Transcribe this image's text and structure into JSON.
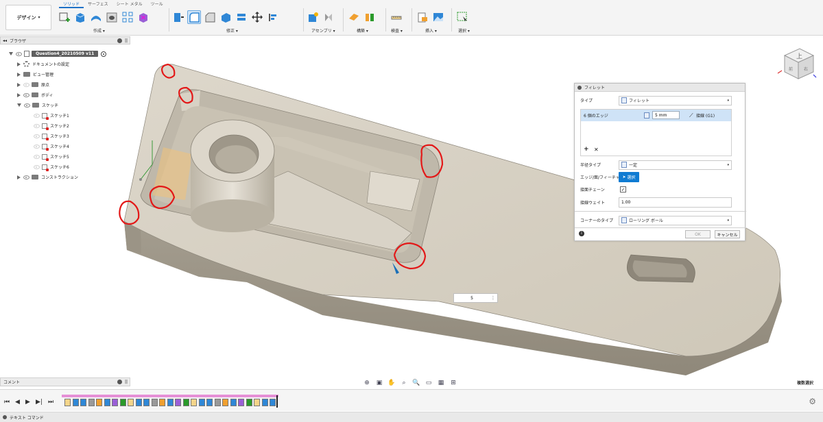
{
  "toolbar": {
    "design_label": "デザイン",
    "tabs": [
      "ソリッド",
      "サーフェス",
      "シート メタル",
      "ツール"
    ],
    "groups": [
      "作成",
      "修正",
      "アセンブリ",
      "構築",
      "検査",
      "挿入",
      "選択"
    ]
  },
  "browser": {
    "title": "ブラウザ",
    "root": "Question4_20210509 v11",
    "items": [
      "ドキュメントの設定",
      "ビュー管理",
      "原点",
      "ボディ",
      "スケッチ",
      "コンストラクション"
    ],
    "sketches": [
      "スケッチ1",
      "スケッチ2",
      "スケッチ3",
      "スケッチ4",
      "スケッチ5",
      "スケッチ6"
    ]
  },
  "comment": {
    "label": "コメント"
  },
  "dialog": {
    "title": "フィレット",
    "type_label": "タイプ",
    "type_value": "フィレット",
    "edge_count": "6 個のエッジ",
    "radius": "5 mm",
    "continuity": "接線 (G1)",
    "radius_type_label": "半径タイプ",
    "radius_type_value": "一定",
    "edge_face_feature_label": "エッジ/面/フィーチャ",
    "select_label": "選択",
    "tangent_chain_label": "接面チェーン",
    "tangent_weight_label": "接線ウェイト",
    "tangent_weight_value": "1.00",
    "corner_type_label": "コーナーのタイプ",
    "corner_type_value": "ローリング ボール",
    "ok": "OK",
    "cancel": "キャンセル"
  },
  "viewport": {
    "dimension_value": "5",
    "multi_select": "複数選択",
    "viewcube_top": "上",
    "viewcube_front": "前",
    "viewcube_right": "右"
  },
  "timeline": {
    "item_count": 27
  },
  "text_command": {
    "label": "テキスト コマンド"
  },
  "colors": {
    "accent": "#0f7bd2",
    "part": "#d6d0c3",
    "annotation": "#e31818"
  }
}
